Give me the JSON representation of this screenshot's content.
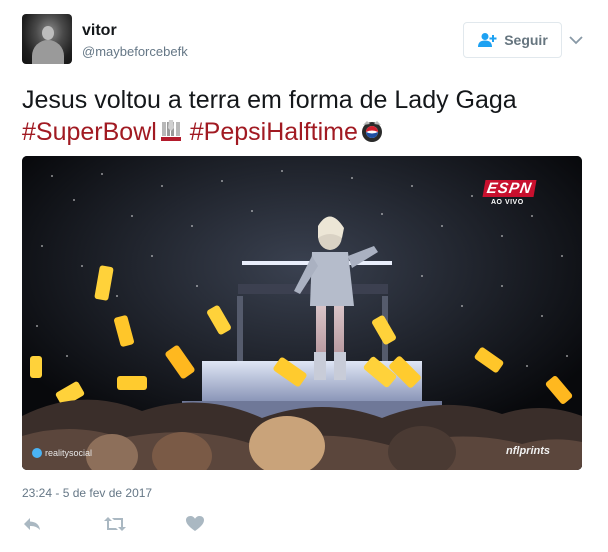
{
  "user": {
    "display_name": "vitor",
    "handle": "@maybeforcebefk",
    "avatar_icon": "user-avatar-icon"
  },
  "follow_button": {
    "label": "Seguir",
    "icon": "follow-person-plus-icon",
    "icon_color": "#1da1f2"
  },
  "caret_icon": "chevron-down-icon",
  "tweet": {
    "text": "Jesus voltou a terra em forma de Lady Gaga",
    "hashtags": [
      {
        "text": "#SuperBowl",
        "hashflag_icon": "super-bowl-li-trophy-icon"
      },
      {
        "text": "#PepsiHalftime",
        "hashflag_icon": "pepsi-halftime-icon"
      }
    ],
    "hashtag_color": "#a11a22"
  },
  "media": {
    "broadcaster_logo": "ESPN",
    "live_label": "AO VIVO",
    "watermark_left": "realitysocial",
    "watermark_right": "nflprints"
  },
  "timestamp": "23:24 - 5 de fev de 2017",
  "actions": [
    {
      "name": "reply",
      "icon": "reply-icon"
    },
    {
      "name": "retweet",
      "icon": "retweet-icon"
    },
    {
      "name": "like",
      "icon": "heart-icon"
    }
  ],
  "colors": {
    "text_primary": "#14171a",
    "text_secondary": "#657786",
    "action_icon": "#aab8c2",
    "border": "#e1e8ed"
  }
}
